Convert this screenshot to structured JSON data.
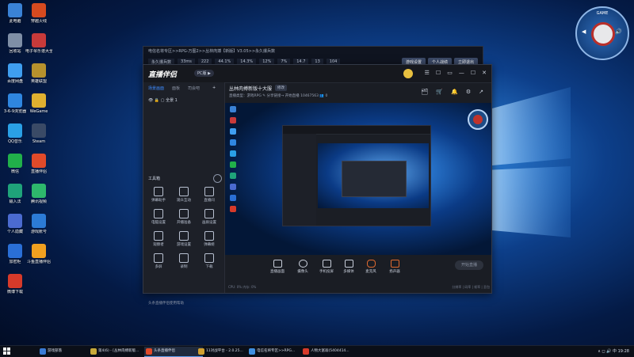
{
  "desktop": {
    "icons": [
      {
        "label": "此电脑",
        "icon": "computer-icon",
        "color": "#3a82d6"
      },
      {
        "label": "穿越火线",
        "icon": "cf-game-icon",
        "color": "#d64a1f"
      },
      {
        "label": "回收站",
        "icon": "recycle-bin-icon",
        "color": "#7f8fa6"
      },
      {
        "label": "电子琴乐谱大全",
        "icon": "music-app-icon",
        "color": "#c83a3a"
      },
      {
        "label": "百度网盘",
        "icon": "cloud-icon",
        "color": "#3f9ef0"
      },
      {
        "label": "英雄联盟",
        "icon": "lol-icon",
        "color": "#b7912d"
      },
      {
        "label": "3-6-9浏览器",
        "icon": "ie-browser-icon",
        "color": "#2f86e0"
      },
      {
        "label": "WeGame",
        "icon": "wegame-icon",
        "color": "#e0b030"
      },
      {
        "label": "QQ音乐",
        "icon": "qq-icon",
        "color": "#2aa0e6"
      },
      {
        "label": "Steam",
        "icon": "steam-icon",
        "color": "#3a4a66"
      },
      {
        "label": "微信",
        "icon": "wechat-icon",
        "color": "#21b04a"
      },
      {
        "label": "直播伴侣",
        "icon": "live-companion-icon",
        "color": "#e04a2a"
      },
      {
        "label": "输入法",
        "icon": "ime-icon",
        "color": "#1fa37a"
      },
      {
        "label": "腾讯视频",
        "icon": "video-player-icon",
        "color": "#2eb86c"
      },
      {
        "label": "个人隐藏",
        "icon": "folder-icon",
        "color": "#4b6bd0"
      },
      {
        "label": "游戏账号",
        "icon": "account-icon",
        "color": "#2c7bd6"
      },
      {
        "label": "加密柜",
        "icon": "lock-app-icon",
        "color": "#2a6fd6"
      },
      {
        "label": "斗鱼直播伴侣",
        "icon": "douyu-icon",
        "color": "#f0a020"
      },
      {
        "label": "微博下载",
        "icon": "weibo-icon",
        "color": "#d63a2a"
      }
    ]
  },
  "back_window": {
    "title": "电信名将专区>>RPG-万图2>>丛林肉搏【新版】V3.05>>永久爆兵数",
    "stats": [
      "永久爆兵数",
      "33ms",
      "222",
      "44.1%",
      "14.3%",
      "12%",
      "7%",
      "14.7",
      "13",
      "104"
    ],
    "buttons": [
      "游戏设置",
      "个人战绩",
      "立即退出"
    ]
  },
  "main_window": {
    "logo": "直播伴侣",
    "version": "PC版 ▶",
    "title_controls": [
      "☰",
      "☐",
      "▭",
      "—",
      "☐",
      "✕"
    ],
    "left": {
      "tabs": [
        "场景画面",
        "面板",
        "司会吧"
      ],
      "scene": "全景 1",
      "tools_title": "工具箱",
      "tools": [
        {
          "label": "弹幕助手"
        },
        {
          "label": "观众互动"
        },
        {
          "label": "直播间"
        },
        {
          "label": "电脑设置"
        },
        {
          "label": "开播准备"
        },
        {
          "label": "画质设置"
        },
        {
          "label": "观察者"
        },
        {
          "label": "游戏设置"
        },
        {
          "label": "弹幕姬"
        },
        {
          "label": "多屏"
        },
        {
          "label": "录制"
        },
        {
          "label": "下载"
        }
      ],
      "bottom_link": "头条直播伴侣使用帮助"
    },
    "right": {
      "room_title": "丛林肉搏新版十大服",
      "room_badge": "修改",
      "room_sub": "直播类型：游戏RPG ✎   分享链接→ 开始直播  10467563  👥  0",
      "icons": [
        "🗂",
        "🛒",
        "🔔",
        "⚙",
        "↗"
      ],
      "bottom_items": [
        "直播画面",
        "摄像头",
        "手机投屏",
        "多媒体",
        "麦克风",
        "扬声器"
      ],
      "live_button": "开始直播",
      "status_left": "CPU: 0% 内存: 0%",
      "status_right": "分辨率 | 码率 | 帧率 | 丢包"
    }
  },
  "widget": {
    "label": "GAME",
    "sides": [
      "◀",
      "🔊"
    ]
  },
  "taskbar": {
    "items": [
      {
        "label": "游戏部落",
        "color": "#3a7bd5",
        "active": false
      },
      {
        "label": "第4(6) - [丛林肉搏新版...",
        "color": "#c8aa3a",
        "active": false
      },
      {
        "label": "头条直播伴侣",
        "color": "#e04a2a",
        "active": true
      },
      {
        "label": "11对战平台 - 2.0.25...",
        "color": "#d0a030",
        "active": false
      },
      {
        "label": "电信名将专区>>RPG...",
        "color": "#3f8fe0",
        "active": false
      },
      {
        "label": "人物大富翁(5404414...",
        "color": "#d63a2a",
        "active": false
      }
    ],
    "tray": "∧  ◻  🔊  中  19:28"
  },
  "colors": {
    "accent": "#3d8bff",
    "brand": "#e04a2a"
  }
}
